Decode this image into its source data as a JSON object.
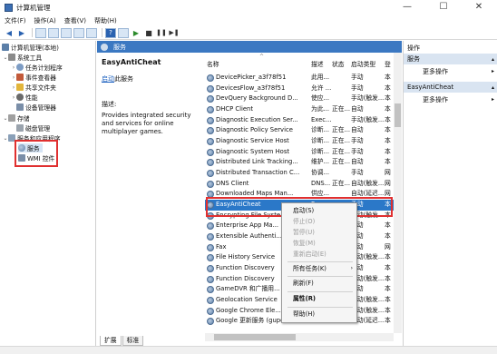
{
  "window": {
    "title": "计算机管理",
    "minimize": "—",
    "maximize": "☐",
    "close": "✕"
  },
  "menubar": [
    "文件(F)",
    "操作(A)",
    "查看(V)",
    "帮助(H)"
  ],
  "tree": {
    "root": "计算机管理(本地)",
    "items": [
      {
        "label": "系统工具",
        "level": 1
      },
      {
        "label": "任务计划程序",
        "level": 2
      },
      {
        "label": "事件查看器",
        "level": 2
      },
      {
        "label": "共享文件夹",
        "level": 2
      },
      {
        "label": "性能",
        "level": 2
      },
      {
        "label": "设备管理器",
        "level": 2
      },
      {
        "label": "存储",
        "level": 1
      },
      {
        "label": "磁盘管理",
        "level": 2
      },
      {
        "label": "服务和应用程序",
        "level": 1
      },
      {
        "label": "服务",
        "level": 2
      },
      {
        "label": "WMI 控件",
        "level": 2
      }
    ]
  },
  "center": {
    "header_title": "服务",
    "description": {
      "service_name": "EasyAntiCheat",
      "link_text": "启动",
      "link_tail": "此服务",
      "label": "描述:",
      "body": "Provides integrated security and services for online multiplayer games."
    },
    "columns": {
      "name": "名称",
      "desc": "描述",
      "status": "状态",
      "startup": "启动类型",
      "logon": "登"
    },
    "services": [
      {
        "name": "DevicePicker_a3f78f51",
        "desc": "此用...",
        "status": "",
        "startup": "手动",
        "logon": "本"
      },
      {
        "name": "DevicesFlow_a3f78f51",
        "desc": "允许 ...",
        "status": "",
        "startup": "手动",
        "logon": "本"
      },
      {
        "name": "DevQuery Background D...",
        "desc": "使应...",
        "status": "",
        "startup": "手动(触发...",
        "logon": "本"
      },
      {
        "name": "DHCP Client",
        "desc": "为此...",
        "status": "正在...",
        "startup": "自动",
        "logon": "本"
      },
      {
        "name": "Diagnostic Execution Ser...",
        "desc": "Exec...",
        "status": "",
        "startup": "手动(触发...",
        "logon": "本"
      },
      {
        "name": "Diagnostic Policy Service",
        "desc": "诊断...",
        "status": "正在...",
        "startup": "自动",
        "logon": "本"
      },
      {
        "name": "Diagnostic Service Host",
        "desc": "诊断...",
        "status": "正在...",
        "startup": "手动",
        "logon": "本"
      },
      {
        "name": "Diagnostic System Host",
        "desc": "诊断...",
        "status": "正在...",
        "startup": "手动",
        "logon": "本"
      },
      {
        "name": "Distributed Link Tracking...",
        "desc": "维护...",
        "status": "正在...",
        "startup": "自动",
        "logon": "本"
      },
      {
        "name": "Distributed Transaction C...",
        "desc": "协调...",
        "status": "",
        "startup": "手动",
        "logon": "网"
      },
      {
        "name": "DNS Client",
        "desc": "DNS...",
        "status": "正在...",
        "startup": "自动(触发...",
        "logon": "网"
      },
      {
        "name": "Downloaded Maps Man...",
        "desc": "供应...",
        "status": "",
        "startup": "自动(延迟...",
        "logon": "网"
      },
      {
        "name": "EasyAntiCheat",
        "desc": "Prov...",
        "status": "",
        "startup": "手动",
        "logon": "本"
      },
      {
        "name": "Encrypting File Syste...",
        "desc": "",
        "status": "",
        "startup": "手动(触发...",
        "logon": "本"
      },
      {
        "name": "Enterprise App Ma...",
        "desc": "",
        "status": "",
        "startup": "手动",
        "logon": "本"
      },
      {
        "name": "Extensible Authenti...",
        "desc": "",
        "status": "",
        "startup": "手动",
        "logon": "本"
      },
      {
        "name": "Fax",
        "desc": "",
        "status": "",
        "startup": "手动",
        "logon": "网"
      },
      {
        "name": "File History Service",
        "desc": "",
        "status": "",
        "startup": "手动(触发...",
        "logon": "本"
      },
      {
        "name": "Function Discovery",
        "desc": "",
        "status": "",
        "startup": "手动",
        "logon": "本"
      },
      {
        "name": "Function Discovery",
        "desc": "",
        "status": "",
        "startup": "手动(触发...",
        "logon": "本"
      },
      {
        "name": "GameDVR 和广播用...",
        "desc": "",
        "status": "",
        "startup": "手动",
        "logon": "本"
      },
      {
        "name": "Geolocation Service",
        "desc": "",
        "status": "",
        "startup": "手动(触发...",
        "logon": "本"
      },
      {
        "name": "Google Chrome Ele...",
        "desc": "",
        "status": "",
        "startup": "手动(触发...",
        "logon": "本"
      },
      {
        "name": "Google 更新服务 (gupdate)",
        "desc": "",
        "status": "",
        "startup": "自动(延迟...",
        "logon": "本"
      }
    ]
  },
  "tabs": [
    "扩展",
    "标准"
  ],
  "actions": {
    "header": "操作",
    "sections": [
      {
        "title": "服务",
        "item": "更多操作"
      },
      {
        "title": "EasyAntiCheat",
        "item": "更多操作"
      }
    ]
  },
  "context_menu": {
    "items": [
      {
        "label": "启动(S)",
        "enabled": true
      },
      {
        "label": "停止(O)",
        "enabled": false
      },
      {
        "label": "暂停(U)",
        "enabled": false
      },
      {
        "label": "恢复(M)",
        "enabled": false
      },
      {
        "label": "重新启动(E)",
        "enabled": false
      },
      {
        "label": "所有任务(K)",
        "enabled": true,
        "submenu": true
      },
      {
        "label": "刷新(F)",
        "enabled": true
      },
      {
        "label": "属性(R)",
        "enabled": true,
        "bold": true
      },
      {
        "label": "帮助(H)",
        "enabled": true
      }
    ]
  },
  "icons": {
    "submenu_arrow": "›",
    "expand_arrow": "›",
    "collapse_arrow": "⌄",
    "section_arrow": "▴",
    "action_more": "▸"
  }
}
